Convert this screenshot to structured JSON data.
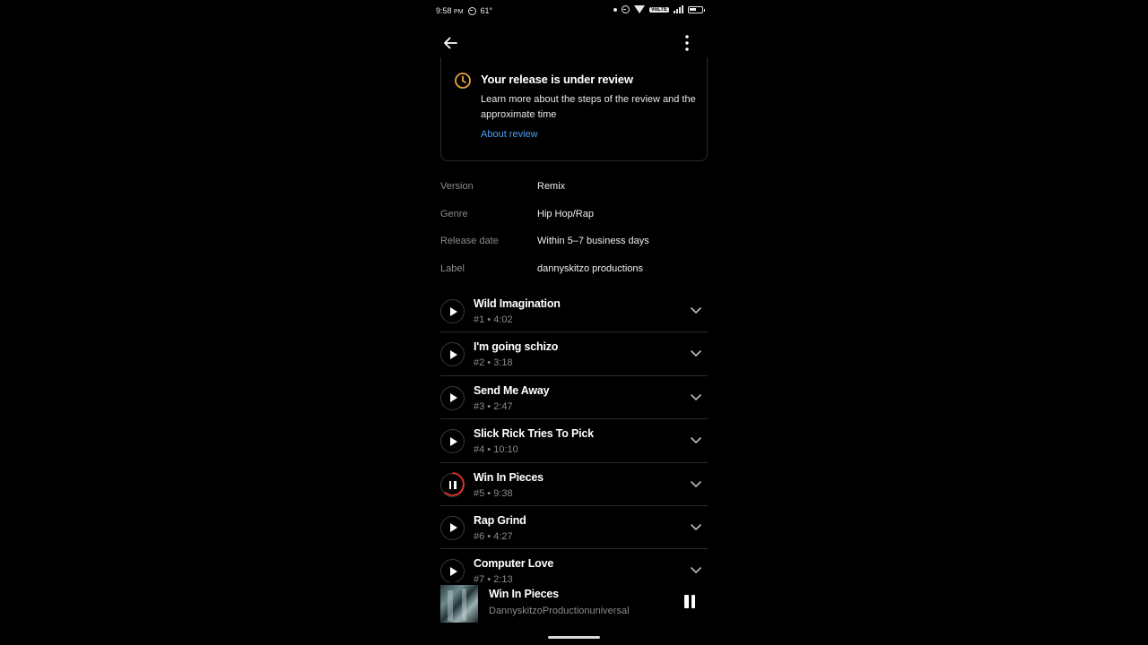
{
  "status_bar": {
    "time": "9:58",
    "ampm": "PM",
    "temperature": "61°",
    "volte": "VoLTE",
    "icons": [
      "dnd-icon",
      "wifi-icon",
      "signal-icon",
      "battery-icon"
    ]
  },
  "app_bar": {
    "back_icon": "arrow-left-icon",
    "more_icon": "more-vertical-icon"
  },
  "review": {
    "title": "Your release is under review",
    "description": "Learn more about the steps of the review and the approximate time",
    "link": "About review",
    "icon": "clock-icon",
    "accent_color": "#e8a33a",
    "link_color": "#4a9ff5"
  },
  "details": [
    {
      "label": "Version",
      "value": "Remix"
    },
    {
      "label": "Genre",
      "value": "Hip Hop/Rap"
    },
    {
      "label": "Release date",
      "value": "Within 5–7 business days"
    },
    {
      "label": "Label",
      "value": "dannyskitzo productions"
    }
  ],
  "tracks": [
    {
      "title": "Wild Imagination",
      "meta": "#1 • 4:02",
      "state": "play"
    },
    {
      "title": "I'm going schizo",
      "meta": "#2 • 3:18",
      "state": "play"
    },
    {
      "title": "Send Me Away",
      "meta": "#3 • 2:47",
      "state": "play"
    },
    {
      "title": "Slick Rick Tries To Pick",
      "meta": "#4 • 10:10",
      "state": "play"
    },
    {
      "title": "Win In Pieces",
      "meta": "#5 • 9:38",
      "state": "playing"
    },
    {
      "title": "Rap Grind",
      "meta": "#6 • 4:27",
      "state": "play"
    },
    {
      "title": "Computer Love",
      "meta": "#7 • 2:13",
      "state": "play"
    }
  ],
  "progress_ring_color": "#e0312b",
  "mini_player": {
    "title": "Win In Pieces",
    "artist": "DannyskitzoProductionuniversal",
    "control_icon": "pause-icon"
  }
}
